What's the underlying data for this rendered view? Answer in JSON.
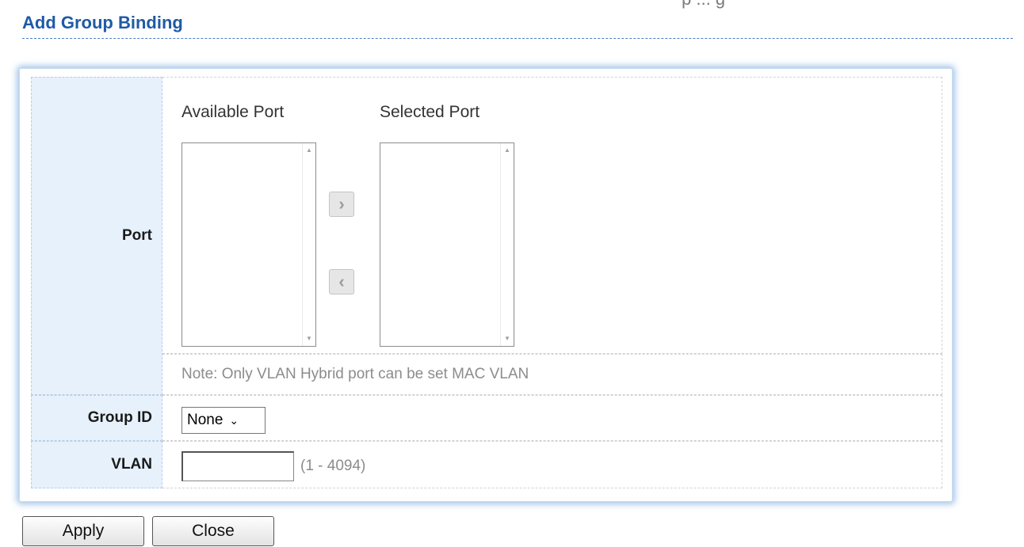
{
  "top_partial_text": "p ... g",
  "page_title": "Add Group Binding",
  "port": {
    "label": "Port",
    "available_title": "Available Port",
    "selected_title": "Selected Port",
    "available_items": [],
    "selected_items": [],
    "move_right_glyph": "›",
    "move_left_glyph": "‹",
    "scroll_up_glyph": "▲",
    "scroll_down_glyph": "▼",
    "note": "Note: Only VLAN Hybrid port can be set MAC VLAN"
  },
  "group_id": {
    "label": "Group ID",
    "selected": "None",
    "chevron": "⌄"
  },
  "vlan": {
    "label": "VLAN",
    "value": "",
    "range": "(1 - 4094)"
  },
  "buttons": {
    "apply": "Apply",
    "close": "Close"
  },
  "colors": {
    "title": "#1f5aa6",
    "label_bg": "#e6f1fc",
    "panel_glow": "#5c96d7"
  }
}
